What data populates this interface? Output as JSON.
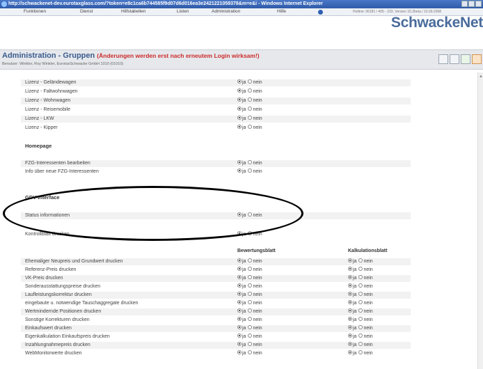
{
  "window": {
    "title": "http://schwackenet-dev.eurotaxglass.com/?token=e8c1ca6b744585f9d07d6d016ea3e2421221059378&m=e&i - Windows Internet Explorer"
  },
  "menu": {
    "items": [
      "Funktionen",
      "Dienst",
      "Hilfstabellen",
      "Listen",
      "Administration",
      "Hilfe"
    ],
    "hotline": "Hotline: 06181 / 405 - 233, Version 10.2beta / 10.09.2008"
  },
  "brand": "SchwackeNet",
  "header": {
    "title": "Administration - Gruppen",
    "note": "(Änderungen werden erst nach erneutem Login wirksam!)",
    "user": "Benutzer: Winkler, Roy Winkler, EurotaxSchwacke GmbH 1010 (01010)"
  },
  "radio": {
    "yes": "ja",
    "no": "nein"
  },
  "licenses": [
    {
      "label": "Lizenz - Geländewagen",
      "value": "ja"
    },
    {
      "label": "Lizenz - Faltwohnwagen",
      "value": "ja"
    },
    {
      "label": "Lizenz - Wohnwagen",
      "value": "ja"
    },
    {
      "label": "Lizenz - Reisemobile",
      "value": "ja"
    },
    {
      "label": "Lizenz - LKW",
      "value": "ja"
    },
    {
      "label": "Lizenz - Kipper",
      "value": "ja"
    }
  ],
  "homepage": {
    "heading": "Homepage",
    "rows": [
      {
        "label": "FZG-Interessenten bearbeiten",
        "value": "ja"
      },
      {
        "label": "Info über neue FZG-Interessenten",
        "value": "ja"
      }
    ]
  },
  "gdv": {
    "heading": "GDV-Interface",
    "rows": [
      {
        "label": "Status informationen",
        "value": "ja"
      }
    ]
  },
  "kontrollblatt": {
    "label": "Kontrollblatt drucken",
    "value": "ja"
  },
  "print": {
    "col1": "Bewertungsblatt",
    "col2": "Kalkulationsblatt",
    "rows": [
      {
        "label": "Ehemaliger Neupreis und Grundwert drucken",
        "v1": "ja",
        "v2": "ja"
      },
      {
        "label": "Referenz-Preis drucken",
        "v1": "ja",
        "v2": "ja"
      },
      {
        "label": "VK-Preis drucken",
        "v1": "ja",
        "v2": "ja"
      },
      {
        "label": "Sonderausstattungspreise drucken",
        "v1": "ja",
        "v2": "ja"
      },
      {
        "label": "Laufleistungskorrektur drucken",
        "v1": "ja",
        "v2": "ja"
      },
      {
        "label": "eingebaute u. notwendige Tauschaggregate drucken",
        "v1": "ja",
        "v2": "ja"
      },
      {
        "label": "Wertmindernde Positionen drucken",
        "v1": "ja",
        "v2": "ja"
      },
      {
        "label": "Sonstige Korrekturen drucken",
        "v1": "ja",
        "v2": "ja"
      },
      {
        "label": "Einkaufswert drucken",
        "v1": "ja",
        "v2": "ja"
      },
      {
        "label": "Eigenkalkulation Einkaufspreis drucken",
        "v1": "ja",
        "v2": "ja"
      },
      {
        "label": "Inzahlungnahmepreis drucken",
        "v1": "ja",
        "v2": "ja"
      },
      {
        "label": "WebMonitorwerte drucken",
        "v1": "ja",
        "v2": "ja"
      }
    ]
  }
}
